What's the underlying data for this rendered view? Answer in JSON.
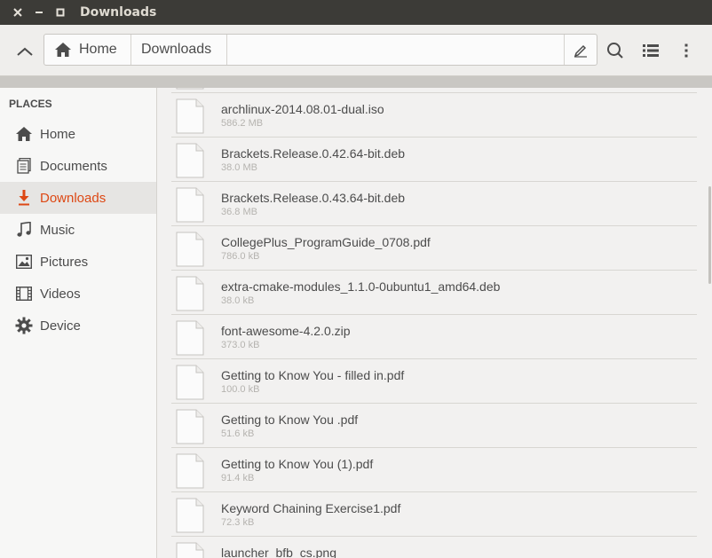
{
  "window": {
    "title": "Downloads"
  },
  "header": {
    "breadcrumbs": [
      {
        "label": "Home",
        "icon": "home-icon"
      },
      {
        "label": "Downloads"
      }
    ],
    "icons": [
      "up-arrow-icon",
      "edit-icon",
      "search-icon",
      "list-view-icon",
      "menu-icon"
    ]
  },
  "sidebar": {
    "header": "PLACES",
    "items": [
      {
        "label": "Home",
        "icon": "home-icon",
        "active": false
      },
      {
        "label": "Documents",
        "icon": "documents-icon",
        "active": false
      },
      {
        "label": "Downloads",
        "icon": "download-icon",
        "active": true
      },
      {
        "label": "Music",
        "icon": "music-icon",
        "active": false
      },
      {
        "label": "Pictures",
        "icon": "pictures-icon",
        "active": false
      },
      {
        "label": "Videos",
        "icon": "videos-icon",
        "active": false
      },
      {
        "label": "Device",
        "icon": "device-icon",
        "active": false
      }
    ]
  },
  "files": [
    {
      "name": "archlinux-2014.08.01-dual.iso",
      "size": "586.2 MB"
    },
    {
      "name": "Brackets.Release.0.42.64-bit.deb",
      "size": "38.0 MB"
    },
    {
      "name": "Brackets.Release.0.43.64-bit.deb",
      "size": "36.8 MB"
    },
    {
      "name": "CollegePlus_ProgramGuide_0708.pdf",
      "size": "786.0 kB"
    },
    {
      "name": "extra-cmake-modules_1.1.0-0ubuntu1_amd64.deb",
      "size": "38.0 kB"
    },
    {
      "name": "font-awesome-4.2.0.zip",
      "size": "373.0 kB"
    },
    {
      "name": "Getting to Know You - filled in.pdf",
      "size": "100.0 kB"
    },
    {
      "name": "Getting to Know You .pdf",
      "size": "51.6 kB"
    },
    {
      "name": "Getting to Know You (1).pdf",
      "size": "91.4 kB"
    },
    {
      "name": "Keyword Chaining Exercise1.pdf",
      "size": "72.3 kB"
    },
    {
      "name": "launcher_bfb_cs.png",
      "size": ""
    }
  ],
  "colors": {
    "accent": "#dd4814",
    "titlebar": "#3c3b37"
  }
}
